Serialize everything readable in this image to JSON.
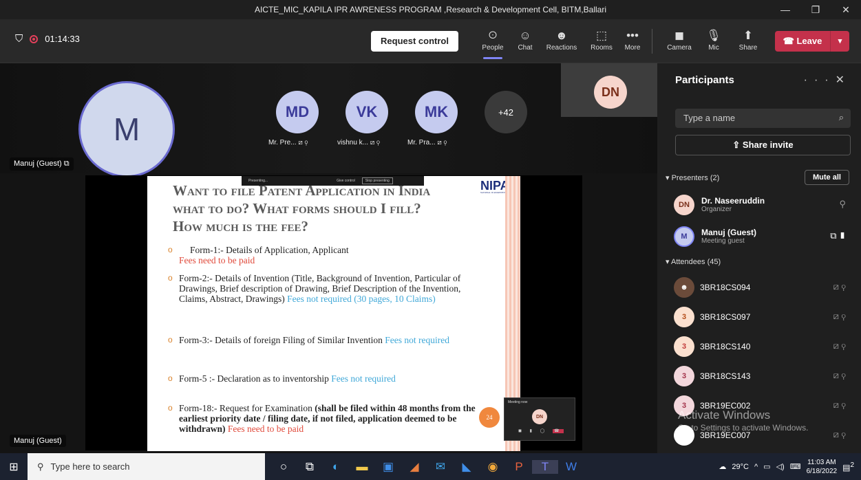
{
  "window": {
    "title": "AICTE_MIC_KAPILA IPR AWRENESS PROGRAM ,Research & Development Cell, BITM,Ballari",
    "min": "—",
    "max": "❐",
    "close": "✕"
  },
  "toolbar": {
    "timer": "01:14:33",
    "request_control": "Request control",
    "items": [
      {
        "label": "People",
        "icon": "people-icon",
        "glyph": "ꖴ"
      },
      {
        "label": "Chat",
        "icon": "chat-icon",
        "glyph": "☺"
      },
      {
        "label": "Reactions",
        "icon": "reactions-icon",
        "glyph": "☻"
      },
      {
        "label": "Rooms",
        "icon": "rooms-icon",
        "glyph": "⬚"
      },
      {
        "label": "More",
        "icon": "more-icon",
        "glyph": "•••"
      },
      {
        "label": "Camera",
        "icon": "camera-off-icon",
        "glyph": "◼"
      },
      {
        "label": "Mic",
        "icon": "mic-off-icon",
        "glyph": "🎙"
      },
      {
        "label": "Share",
        "icon": "share-icon",
        "glyph": "⬆"
      }
    ],
    "leave": "Leave",
    "leave_color": "#c4314b"
  },
  "gallery": {
    "main": {
      "initial": "M",
      "name": "Manuj (Guest)"
    },
    "tiles": [
      {
        "initials": "MD",
        "name": "Mr. Pre..."
      },
      {
        "initials": "VK",
        "name": "vishnu k..."
      },
      {
        "initials": "MK",
        "name": "Mr. Pra..."
      }
    ],
    "more": "+42",
    "dn_tile": "DN"
  },
  "presenting_bar": {
    "status": "Presenting...",
    "give_control": "Give control",
    "stop": "Stop presenting"
  },
  "slide": {
    "title_line1": "Want to file Patent Application in India",
    "title_line2": "what to do?   What forms should I fill?",
    "title_line3": "How much is the fee?",
    "logo": "NIPAM",
    "logo_sub": "NATIONAL IP AWARENESS MISSION",
    "bullets": [
      {
        "text": "Form-1:- Details of Application, Applicant ",
        "fee": "Fees need to be paid"
      },
      {
        "text": "Form-2:- Details of Invention (Title, Background of Invention, Particular of Drawings, Brief description of Drawing, Brief Description of the Invention,  Claims, Abstract, Drawings) ",
        "fee": "Fees not required (30 pages, 10 Claims)"
      },
      {
        "text": "Form-3:- Details of foreign Filing of Similar Invention ",
        "fee": "Fees not required"
      },
      {
        "text": "Form-5 :- Declaration as to inventorship ",
        "fee": "Fees not required"
      },
      {
        "text": "Form-18:- Request for Examination ",
        "bold": "(shall be filed within 48 months from the earliest priority date / filing date, if not filed, application deemed to be withdrawn) ",
        "fee": "Fees need to be paid"
      }
    ],
    "page": "24",
    "mini_label": "Meeting now",
    "mini_initials": "DN"
  },
  "stage_bottom_name": "Manuj (Guest)",
  "panel": {
    "title": "Participants",
    "search_placeholder": "Type a name",
    "share_invite": "Share invite",
    "presenters_header": "Presenters (2)",
    "mute_all": "Mute all",
    "presenters": [
      {
        "initials": "DN",
        "name": "Dr. Naseeruddin",
        "role": "Organizer"
      },
      {
        "initials": "M",
        "name": "Manuj (Guest)",
        "role": "Meeting guest"
      }
    ],
    "attendees_header": "Attendees (45)",
    "attendees": [
      {
        "initials": "",
        "name": "3BR18CS094"
      },
      {
        "initials": "3",
        "name": "3BR18CS097"
      },
      {
        "initials": "3",
        "name": "3BR18CS140"
      },
      {
        "initials": "3",
        "name": "3BR18CS143"
      },
      {
        "initials": "3",
        "name": "3BR19EC002"
      },
      {
        "initials": "",
        "name": "3BR19EC007"
      }
    ]
  },
  "watermark": {
    "line1": "Activate Windows",
    "line2": "Go to Settings to activate Windows."
  },
  "taskbar": {
    "search": "Type here to search",
    "temp": "29°C",
    "time": "11:03 AM",
    "date": "6/18/2022",
    "notif": "2"
  }
}
